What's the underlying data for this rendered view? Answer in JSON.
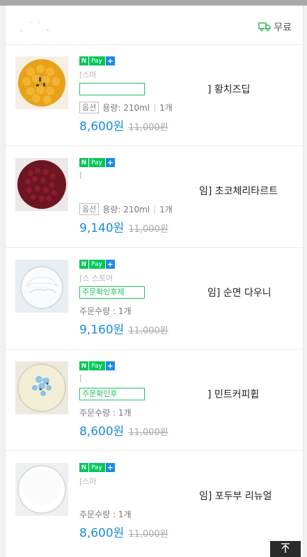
{
  "header": {
    "store_name": "ˎ   ˙  ˙ ˎ",
    "shipping_label": "무료",
    "truck_icon": "truck-icon"
  },
  "colors": {
    "price": "#1a8cd8",
    "npay_green": "#03c75a",
    "plus_blue": "#1e88e5",
    "badge_green": "#20c05c"
  },
  "items": [
    {
      "seller": "[스마   ",
      "badge": "",
      "title": "] 황치즈딥",
      "option_tag": "옵션",
      "option_text": "용량: 210ml",
      "quantity": "1개",
      "price": "8,600원",
      "original_price": "11,000원"
    },
    {
      "seller": "[",
      "badge": "",
      "title": "임] 초코체리타르트",
      "option_tag": "옵션",
      "option_text": "용량: 210ml",
      "quantity": "1개",
      "price": "9,140원",
      "original_price": "11,000원"
    },
    {
      "seller": "[스                     스토어",
      "badge": "주문확인후제",
      "title": "임] 순면 다우니",
      "option_text": "주문수량 : 1개",
      "price": "9,160원",
      "original_price": "11,000원"
    },
    {
      "seller": "[",
      "badge": "주문확인후",
      "title": "] 민트커피휩",
      "option_text": "주문수량 : 1개",
      "price": "8,600원",
      "original_price": "11,000원"
    },
    {
      "seller": "[스마   ",
      "badge": "",
      "title": "임] 포두부 리뉴얼",
      "option_text": "주문수량 : 1개",
      "price": "8,600원",
      "original_price": "11,000원"
    }
  ],
  "scroll_top_icon": "arrow-up-icon"
}
